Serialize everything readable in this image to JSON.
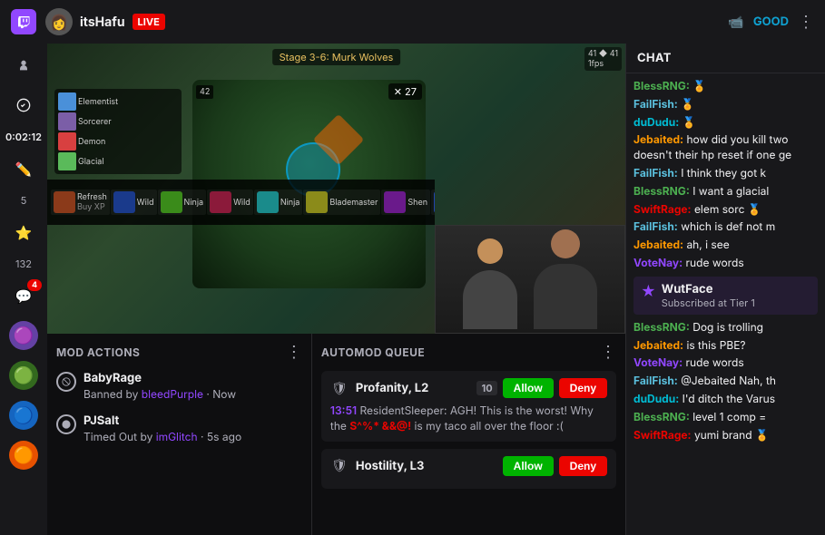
{
  "topbar": {
    "logo": "🎮",
    "streamer": {
      "name": "itsHafu",
      "live_label": "LIVE"
    },
    "stream_quality": "GOOD",
    "menu_icon": "⋮"
  },
  "sidebar": {
    "timer": "0:02:12",
    "icon1": "🔊",
    "icon2": "✏️",
    "count1": "5",
    "icon3": "⚡",
    "count2": "132",
    "icon4_badge": "4",
    "avatars": [
      "purple",
      "green",
      "blue",
      "orange"
    ]
  },
  "game": {
    "title": "Stage 3-6: Murk Wolves",
    "hud_info": "41 ◆ 41\n1fps",
    "round_counter": "✕ 27"
  },
  "mod_actions": {
    "title": "MOD ACTIONS",
    "items": [
      {
        "name": "BabyRage",
        "action": "Banned by",
        "actor": "bleedPurple",
        "time": "Now"
      },
      {
        "name": "PJSalt",
        "action": "Timed Out by",
        "actor": "imGlitch",
        "time": "5s ago"
      }
    ]
  },
  "automod": {
    "title": "AUTOMOD QUEUE",
    "items": [
      {
        "label": "Profanity, L2",
        "level": "10",
        "timestamp": "13:51",
        "user": "ResidentSleeper",
        "message_prefix": "AGH! This is the worst! Why the ",
        "message_highlight": "S^%* &&@!",
        "message_suffix": " is my taco all over the floor :(",
        "allow_label": "Allow",
        "deny_label": "Deny"
      },
      {
        "label": "Hostility, L3",
        "level": "",
        "allow_label": "Allow",
        "deny_label": "Deny"
      }
    ]
  },
  "chat": {
    "title": "CHAT",
    "messages": [
      {
        "user": "BlessRNG",
        "user_color": "green",
        "text": "🏅",
        "suffix": ""
      },
      {
        "user": "FailFish",
        "user_color": "blue",
        "text": "🏅",
        "suffix": ""
      },
      {
        "user": "duDudu",
        "user_color": "teal",
        "text": "🏅",
        "suffix": ""
      },
      {
        "user": "Jebaited",
        "user_color": "orange",
        "text": ": how did you kill two doesn't their hp reset if one ge",
        "suffix": ""
      },
      {
        "user": "FailFish",
        "user_color": "blue",
        "text": ": I think they got k",
        "suffix": ""
      },
      {
        "user": "BlessRNG",
        "user_color": "green",
        "text": ": I want a glacial",
        "suffix": ""
      },
      {
        "user": "SwiftRage",
        "user_color": "red",
        "text": ": elem sorc 🏅",
        "suffix": ""
      },
      {
        "user": "FailFish",
        "user_color": "blue",
        "text": ": which is def not m",
        "suffix": ""
      },
      {
        "user": "Jebaited",
        "user_color": "orange",
        "text": ": ah, i see",
        "suffix": ""
      },
      {
        "user": "VoteNay",
        "user_color": "purple",
        "text": ": rude words",
        "suffix": ""
      },
      {
        "sub_user": "WutFace",
        "sub_tier": "Subscribed at Tier 1"
      },
      {
        "user": "BlessRNG",
        "user_color": "green",
        "text": ": Dog is trolling",
        "suffix": ""
      },
      {
        "user": "Jebaited",
        "user_color": "orange",
        "text": ": is this PBE?",
        "suffix": ""
      },
      {
        "user": "VoteNay",
        "user_color": "purple",
        "text": ": rude words",
        "suffix": ""
      },
      {
        "user": "FailFish",
        "user_color": "blue",
        "text": ": @Jebaited Nah, th",
        "suffix": ""
      },
      {
        "user": "duDudu",
        "user_color": "teal",
        "text": ": I'd ditch the Varus",
        "suffix": ""
      },
      {
        "user": "BlessRNG",
        "user_color": "green",
        "text": ": level 1 comp =",
        "suffix": ""
      },
      {
        "user": "SwiftRage",
        "user_color": "red",
        "text": ": yumi brand 🏅",
        "suffix": ""
      }
    ]
  }
}
